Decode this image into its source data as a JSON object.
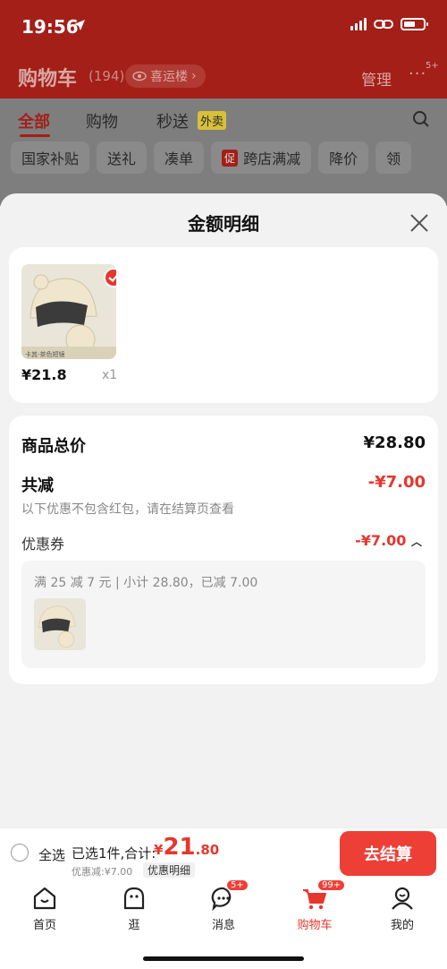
{
  "status_bar": {
    "time": "19:56"
  },
  "header": {
    "title": "购物车",
    "count": "(194)",
    "fav_pill": "喜运楼",
    "manage": "管理",
    "more_badge": "5+"
  },
  "tabs": [
    {
      "label": "全部"
    },
    {
      "label": "购物"
    },
    {
      "label": "秒送"
    }
  ],
  "waimai_tag": "外卖",
  "chips": [
    {
      "label": "国家补贴"
    },
    {
      "label": "送礼"
    },
    {
      "label": "凑单"
    },
    {
      "label": "跨店满减",
      "tag": "促"
    },
    {
      "label": "降价"
    },
    {
      "label": "领"
    }
  ],
  "sheet": {
    "title": "金额明细",
    "item": {
      "price": "¥21.8",
      "qty": "x1",
      "img_caption": "卡其-茶色短镜"
    },
    "total_label": "商品总价",
    "total_value": "¥28.80",
    "reduce_label": "共减",
    "reduce_value": "-¥7.00",
    "note": "以下优惠不包含红包，请在结算页查看",
    "coupon_label": "优惠券",
    "coupon_value": "-¥7.00",
    "coupon_desc": "满 25 减 7 元 | 小计 28.80，已减 7.00"
  },
  "checkout": {
    "select_all": "全选",
    "selected_text": "已选1件,合计:",
    "currency": "¥",
    "price_int": "21",
    "price_dec": ".80",
    "discount_line": "优惠减:¥7.00",
    "detail_pill": "优惠明细",
    "button": "去结算"
  },
  "tabbar": [
    {
      "label": "首页",
      "icon": "home-icon"
    },
    {
      "label": "逛",
      "icon": "browse-icon"
    },
    {
      "label": "消息",
      "icon": "message-icon",
      "badge": "5+"
    },
    {
      "label": "购物车",
      "icon": "cart-icon",
      "badge": "99+",
      "active": true
    },
    {
      "label": "我的",
      "icon": "profile-icon"
    }
  ],
  "colors": {
    "accent": "#ee3f37",
    "brand_dark": "#a31f18"
  }
}
